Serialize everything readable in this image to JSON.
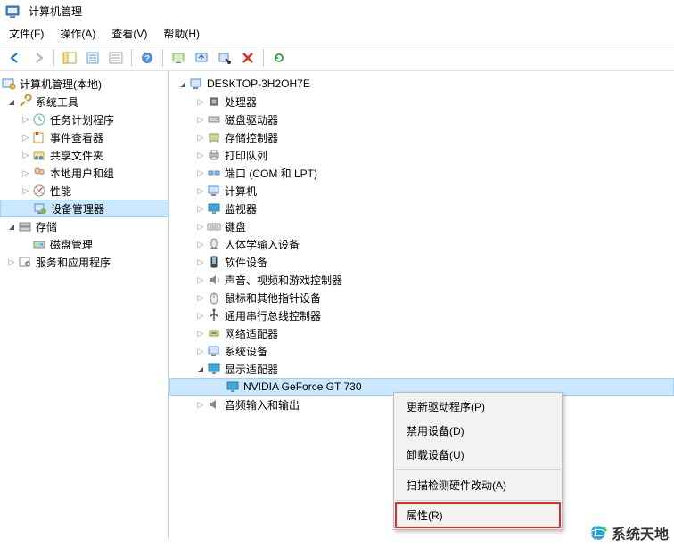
{
  "window": {
    "title": "计算机管理"
  },
  "menu": {
    "file": "文件(F)",
    "action": "操作(A)",
    "view": "查看(V)",
    "help": "帮助(H)"
  },
  "left_tree": {
    "root": "计算机管理(本地)",
    "system_tools": "系统工具",
    "task_scheduler": "任务计划程序",
    "event_viewer": "事件查看器",
    "shared_folders": "共享文件夹",
    "local_users": "本地用户和组",
    "performance": "性能",
    "device_manager": "设备管理器",
    "storage": "存储",
    "disk_mgmt": "磁盘管理",
    "services_apps": "服务和应用程序"
  },
  "right_tree": {
    "root": "DESKTOP-3H2OH7E",
    "processors": "处理器",
    "disk_drives": "磁盘驱动器",
    "storage_ctrl": "存储控制器",
    "print_queues": "打印队列",
    "ports": "端口 (COM 和 LPT)",
    "computer": "计算机",
    "monitors": "监视器",
    "keyboards": "键盘",
    "hid": "人体学输入设备",
    "software_dev": "软件设备",
    "sound": "声音、视频和游戏控制器",
    "mice": "鼠标和其他指针设备",
    "usb": "通用串行总线控制器",
    "network": "网络适配器",
    "system_dev": "系统设备",
    "display": "显示适配器",
    "gpu": "NVIDIA GeForce GT 730",
    "audio_io": "音频输入和输出"
  },
  "context": {
    "update": "更新驱动程序(P)",
    "disable": "禁用设备(D)",
    "uninstall": "卸载设备(U)",
    "scan": "扫描检测硬件改动(A)",
    "properties": "属性(R)"
  },
  "watermark": {
    "text": "系统天地"
  }
}
